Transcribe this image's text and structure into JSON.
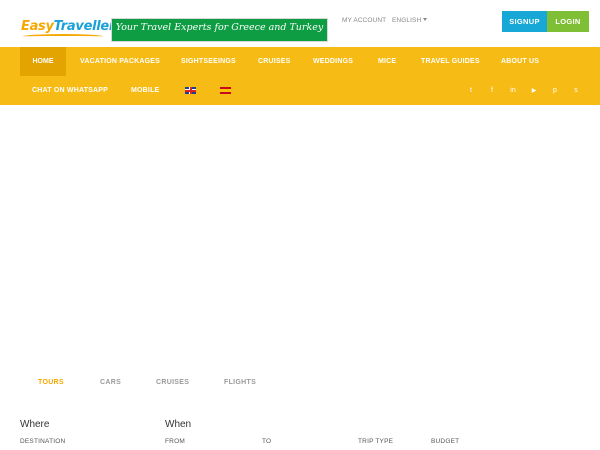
{
  "header": {
    "logo_part1": "Easy",
    "logo_part2": "Traveller.gr",
    "banner_text": "Your Travel Experts for Greece and Turkey",
    "my_account": "MY ACCOUNT",
    "language": "ENGLISH",
    "signup_label": "SIGNUP",
    "login_label": "LOGIN"
  },
  "nav": {
    "items": [
      {
        "label": "HOME",
        "active": true
      },
      {
        "label": "VACATION PACKAGES"
      },
      {
        "label": "SIGHTSEEINGS"
      },
      {
        "label": "CRUISES"
      },
      {
        "label": "WEDDINGS"
      },
      {
        "label": "MICE"
      },
      {
        "label": "TRAVEL GUIDES"
      },
      {
        "label": "ABOUT US"
      },
      {
        "label": "CHAT ON WHATSAPP"
      },
      {
        "label": "MOBILE"
      }
    ],
    "flags": [
      "uk-flag-icon",
      "spain-flag-icon"
    ],
    "social_icons": [
      "twitter-icon",
      "facebook-icon",
      "linkedin-icon",
      "youtube-icon",
      "pinterest-icon",
      "skype-icon"
    ],
    "social_glyphs": [
      "t",
      "f",
      "in",
      "▶",
      "p",
      "s"
    ],
    "background_color": "#f7bb16",
    "active_color": "#e3a300"
  },
  "search": {
    "tabs": [
      {
        "label": "TOURS",
        "active": true
      },
      {
        "label": "CARS"
      },
      {
        "label": "CRUISES"
      },
      {
        "label": "FLIGHTS"
      }
    ],
    "where_title": "Where",
    "when_title": "When",
    "destination_label": "DESTINATION",
    "from_label": "FROM",
    "to_label": "TO",
    "trip_type_label": "TRIP TYPE",
    "budget_label": "BUDGET"
  },
  "colors": {
    "accent": "#f5a800",
    "signup": "#17a8d7",
    "login": "#7fbf35",
    "banner": "#0f9d44"
  }
}
